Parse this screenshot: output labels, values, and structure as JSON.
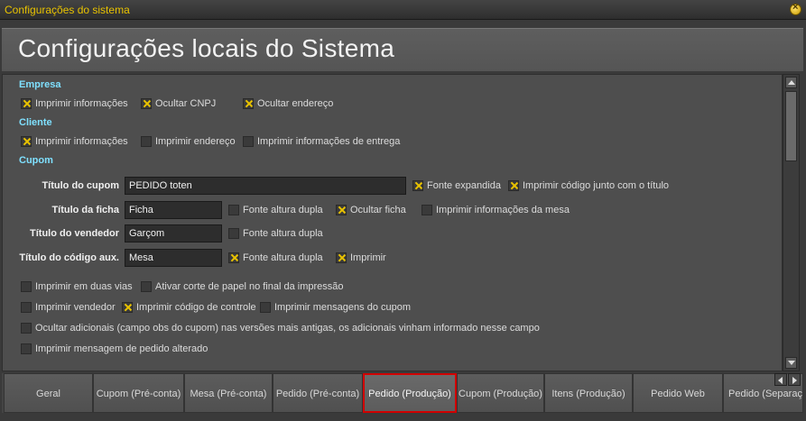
{
  "window": {
    "title": "Configurações do sistema"
  },
  "header": {
    "title": "Configurações locais do Sistema"
  },
  "sections": {
    "empresa": "Empresa",
    "cliente": "Cliente",
    "cupom": "Cupom"
  },
  "empresa": [
    {
      "label": "Imprimir informações",
      "checked": true
    },
    {
      "label": "Ocultar CNPJ",
      "checked": true
    },
    {
      "label": "Ocultar endereço",
      "checked": true
    }
  ],
  "cliente": [
    {
      "label": "Imprimir informações",
      "checked": true
    },
    {
      "label": "Imprimir endereço",
      "checked": false
    },
    {
      "label": "Imprimir informações de entrega",
      "checked": false
    }
  ],
  "cupom": {
    "titulo_cupom": {
      "label": "Título do cupom",
      "value": "PEDIDO toten",
      "options": [
        {
          "label": "Fonte expandida",
          "checked": true
        },
        {
          "label": "Imprimir código junto com o título",
          "checked": true
        }
      ]
    },
    "titulo_ficha": {
      "label": "Título da ficha",
      "value": "Ficha",
      "options": [
        {
          "label": "Fonte altura dupla",
          "checked": false
        },
        {
          "label": "Ocultar ficha",
          "checked": true
        },
        {
          "label": "Imprimir informações da mesa",
          "checked": false
        }
      ]
    },
    "titulo_vendedor": {
      "label": "Título do vendedor",
      "value": "Garçom",
      "options": [
        {
          "label": "Fonte altura dupla",
          "checked": false
        }
      ]
    },
    "titulo_codigo_aux": {
      "label": "Título do código aux.",
      "value": "Mesa",
      "options": [
        {
          "label": "Fonte altura dupla",
          "checked": true
        },
        {
          "label": "Imprimir",
          "checked": true
        }
      ]
    },
    "misc": [
      {
        "label": "Imprimir em duas vias",
        "checked": false
      },
      {
        "label": "Ativar corte de papel no final da impressão",
        "checked": false
      },
      {
        "label": "Imprimir vendedor",
        "checked": false
      },
      {
        "label": "Imprimir código de controle",
        "checked": true
      },
      {
        "label": "Imprimir mensagens do cupom",
        "checked": false
      },
      {
        "label": "Ocultar adicionais (campo obs do cupom) nas versões mais antigas, os adicionais vinham informado nesse campo",
        "checked": false
      },
      {
        "label": "Imprimir mensagem de pedido alterado",
        "checked": false
      }
    ]
  },
  "tabs": [
    {
      "label": "Geral",
      "active": false
    },
    {
      "label": "Cupom (Pré-conta)",
      "active": false
    },
    {
      "label": "Mesa (Pré-conta)",
      "active": false
    },
    {
      "label": "Pedido (Pré-conta)",
      "active": false
    },
    {
      "label": "Pedido (Produção)",
      "active": true
    },
    {
      "label": "Cupom (Produção)",
      "active": false
    },
    {
      "label": "Itens (Produção)",
      "active": false
    },
    {
      "label": "Pedido Web",
      "active": false
    },
    {
      "label": "Pedido (Separação)",
      "active": false
    }
  ],
  "colors": {
    "accent_check": "#e8c200",
    "section_heading": "#7fe0ff",
    "active_tab_outline": "#d10000",
    "title_text": "#e8c200"
  }
}
